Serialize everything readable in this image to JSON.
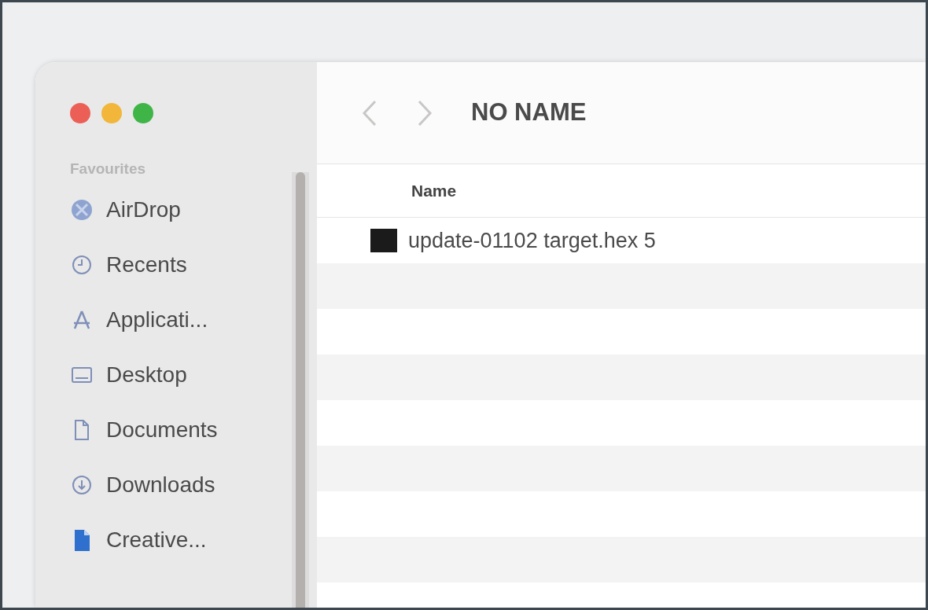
{
  "sidebar": {
    "section": "Favourites",
    "items": [
      {
        "label": "AirDrop"
      },
      {
        "label": "Recents"
      },
      {
        "label": "Applicati..."
      },
      {
        "label": "Desktop"
      },
      {
        "label": "Documents"
      },
      {
        "label": "Downloads"
      },
      {
        "label": "Creative..."
      }
    ]
  },
  "toolbar": {
    "title": "NO NAME"
  },
  "table": {
    "columns": [
      "Name"
    ],
    "rows": [
      {
        "name": "update-01102 target.hex 5"
      }
    ]
  }
}
